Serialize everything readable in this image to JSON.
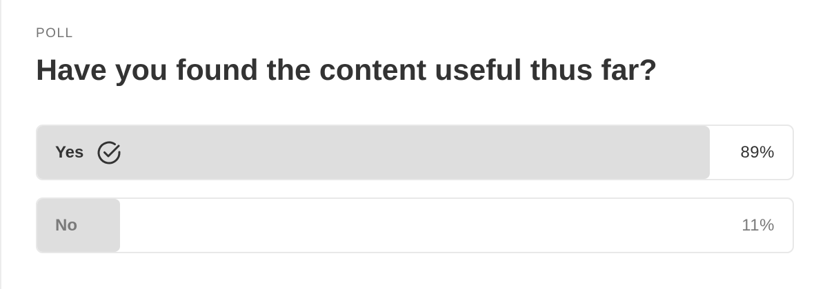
{
  "poll": {
    "label": "POLL",
    "question": "Have you found the content useful thus far?",
    "options": [
      {
        "label": "Yes",
        "percent_text": "89%",
        "share": 0.89,
        "selected": true,
        "icon": "check-circle-icon"
      },
      {
        "label": "No",
        "percent_text": "11%",
        "share": 0.11,
        "selected": false
      }
    ]
  },
  "colors": {
    "fill": "#dedede",
    "text_primary": "#333333",
    "text_muted": "#7a7a7a"
  }
}
